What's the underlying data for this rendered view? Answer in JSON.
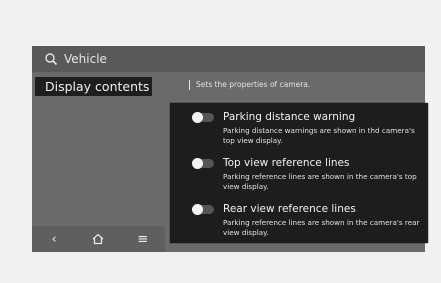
{
  "header": {
    "title": "Vehicle",
    "search_icon": "search-icon"
  },
  "sidebar": {
    "items": [
      {
        "label": "Display contents"
      }
    ]
  },
  "hint": "Sets the properties of camera.",
  "settings": [
    {
      "title": "Parking distance warning",
      "desc": "Parking distance warnings are shown in thd camera's top view display."
    },
    {
      "title": "Top view reference lines",
      "desc": "Parking reference lines are shown in the camera's top view display."
    },
    {
      "title": "Rear view reference lines",
      "desc": "Parking reference lines are shown in the camera's rear view display."
    }
  ],
  "bottom_nav": {
    "back_icon": "back-icon",
    "home_icon": "home-icon",
    "menu_icon": "menu-icon"
  }
}
